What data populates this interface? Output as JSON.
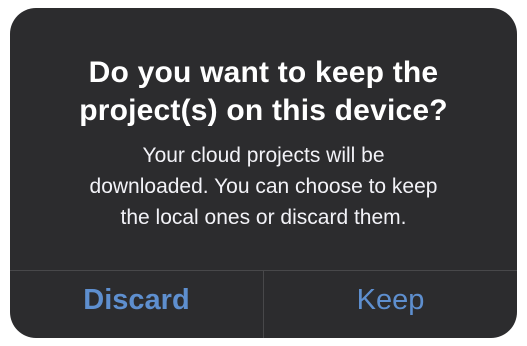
{
  "alert": {
    "title_lines": [
      "Do you want to keep the",
      "project(s) on this device?"
    ],
    "message_lines": [
      "Your cloud projects will be",
      "downloaded. You can choose to keep",
      "the local ones or discard them."
    ],
    "buttons": {
      "discard_label": "Discard",
      "keep_label": "Keep"
    }
  },
  "colors": {
    "alert_background": "#2c2c2e",
    "button_text": "#5e8fcf",
    "divider": "#48484a"
  }
}
